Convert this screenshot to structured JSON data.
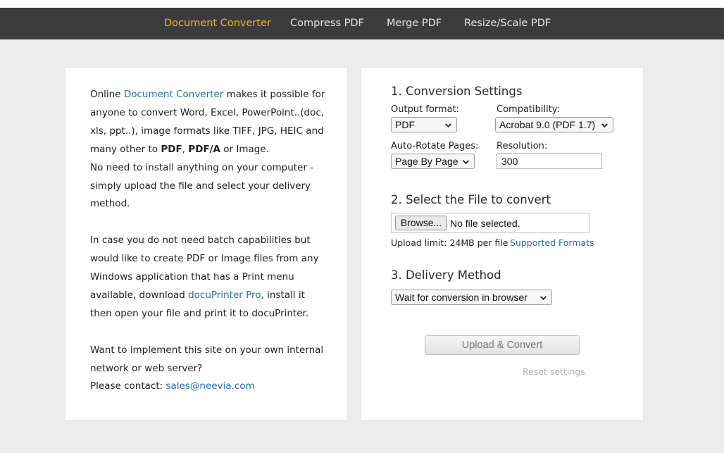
{
  "nav": {
    "items": [
      {
        "label": "Document Converter",
        "active": true
      },
      {
        "label": "Compress PDF",
        "active": false
      },
      {
        "label": "Merge PDF",
        "active": false
      },
      {
        "label": "Resize/Scale PDF",
        "active": false
      }
    ]
  },
  "intro": {
    "p1": {
      "t1": "Online ",
      "link": "Document Converter",
      "t2": " makes it possible for anyone to convert Word, Excel, PowerPoint..(doc, xls, ppt..), image formats like TIFF, JPG, HEIC and many other to ",
      "b1": "PDF",
      "t3": ", ",
      "b2": "PDF/A",
      "t4": " or Image."
    },
    "p2": "No need to install anything on your computer - simply upload the file and select your delivery method.",
    "p3": {
      "t1": "In case you do not need batch capabilities but would like to create PDF or Image files from any Windows application that has a Print menu available, download ",
      "link": "docuPrinter Pro",
      "t2": ", install it then open your file and print it to docuPrinter."
    },
    "p4": "Want to implement this site on your own internal network or web server?",
    "p5": {
      "t1": "Please contact: ",
      "email": "sales@neevia.com"
    }
  },
  "settings": {
    "title": "1. Conversion Settings",
    "output_format": {
      "label": "Output format:",
      "value": "PDF"
    },
    "compatibility": {
      "label": "Compatibility:",
      "value": "Acrobat 9.0 (PDF 1.7)"
    },
    "auto_rotate": {
      "label": "Auto-Rotate Pages:",
      "value": "Page By Page"
    },
    "resolution": {
      "label": "Resolution:",
      "value": "300"
    }
  },
  "file": {
    "title": "2. Select the File to convert",
    "browse_label": "Browse...",
    "status": "No file selected.",
    "upload_limit": "Upload limit: 24MB per file",
    "supported_formats": "Supported Formats"
  },
  "delivery": {
    "title": "3. Delivery Method",
    "value": "Wait for conversion in browser"
  },
  "actions": {
    "upload_label": "Upload & Convert",
    "reset_label": "Reset settings"
  },
  "colors": {
    "nav_bg": "#3c3c3c",
    "nav_active": "#f0b429",
    "link": "#1f6f99",
    "page_bg": "#ececec"
  }
}
